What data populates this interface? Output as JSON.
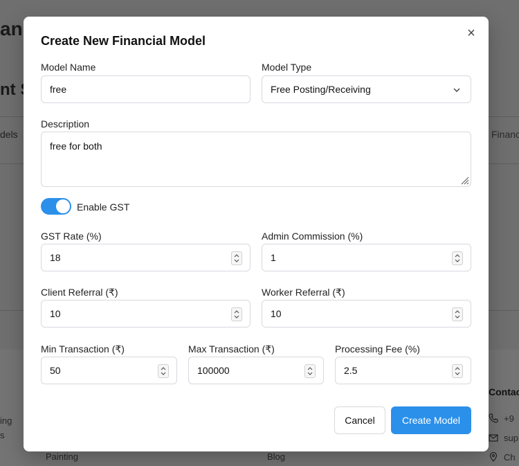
{
  "background": {
    "title_fragment_1": "an",
    "title_fragment_2": "nt S",
    "tab_left": "dels",
    "tab_right": "Financ",
    "footer_contact": "Contac",
    "footer_left_1": "ing",
    "footer_left_2": "s",
    "footer_link_1": "Painting",
    "footer_link_2": "Blog",
    "contact_phone": "+9",
    "contact_email": "sup",
    "contact_location": "Ch"
  },
  "modal": {
    "title": "Create New Financial Model",
    "close_label": "×",
    "model_name": {
      "label": "Model Name",
      "value": "free"
    },
    "model_type": {
      "label": "Model Type",
      "value": "Free Posting/Receiving"
    },
    "description": {
      "label": "Description",
      "value": "free for both"
    },
    "gst_toggle": {
      "label": "Enable GST",
      "enabled": true
    },
    "gst_rate": {
      "label": "GST Rate (%)",
      "value": "18"
    },
    "admin_commission": {
      "label": "Admin Commission (%)",
      "value": "1"
    },
    "client_referral": {
      "label": "Client Referral (₹)",
      "value": "10"
    },
    "worker_referral": {
      "label": "Worker Referral (₹)",
      "value": "10"
    },
    "min_transaction": {
      "label": "Min Transaction (₹)",
      "value": "50"
    },
    "max_transaction": {
      "label": "Max Transaction (₹)",
      "value": "100000"
    },
    "processing_fee": {
      "label": "Processing Fee (%)",
      "value": "2.5"
    },
    "cancel_label": "Cancel",
    "create_label": "Create Model"
  },
  "colors": {
    "accent": "#2b90ea",
    "overlay": "#6f6f6f"
  }
}
